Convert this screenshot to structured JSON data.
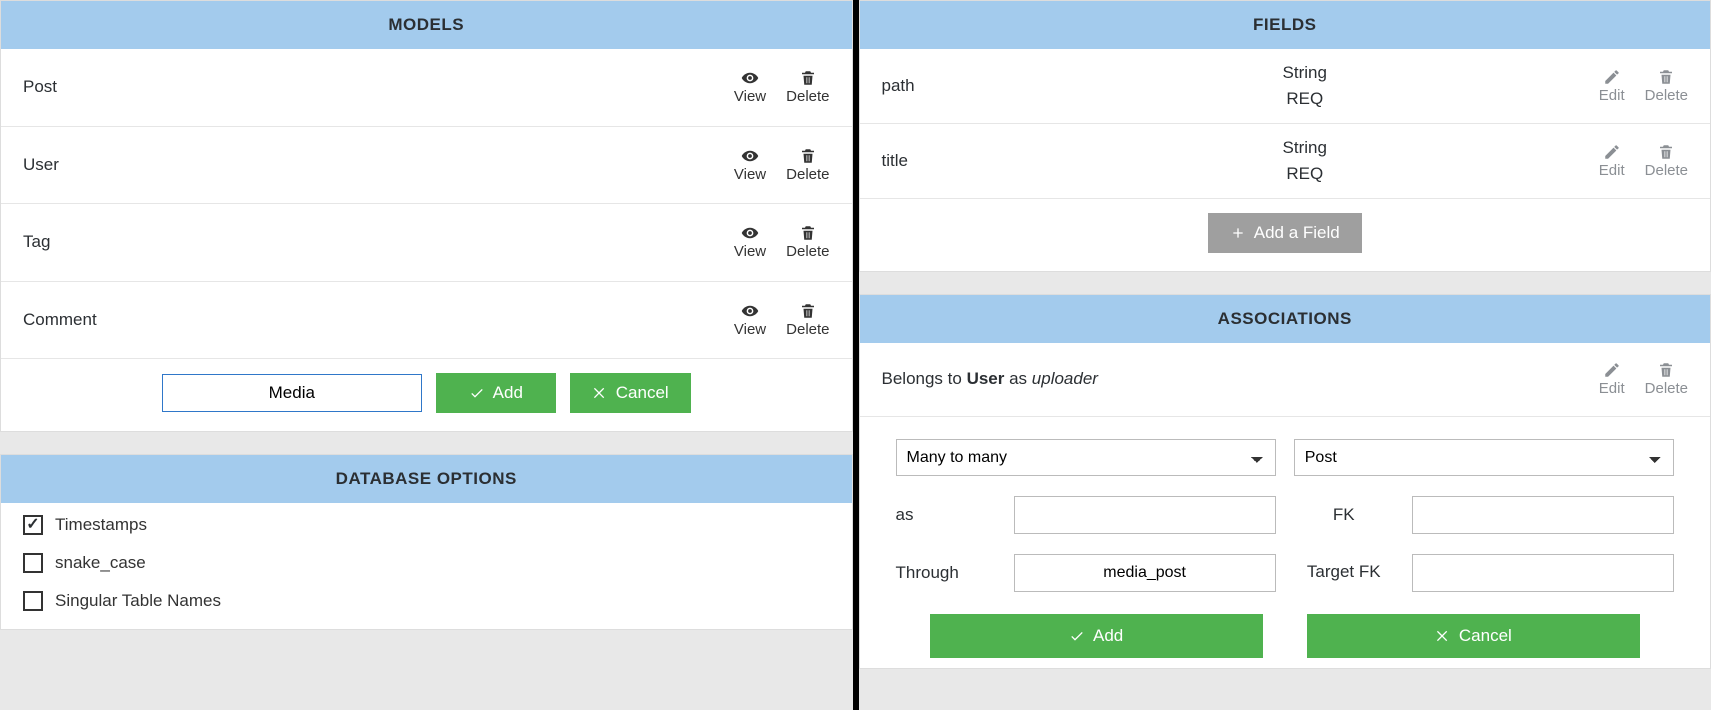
{
  "models": {
    "heading": "MODELS",
    "items": [
      {
        "name": "Post"
      },
      {
        "name": "User"
      },
      {
        "name": "Tag"
      },
      {
        "name": "Comment"
      }
    ],
    "action_view": "View",
    "action_delete": "Delete",
    "new_value": "Media",
    "add_label": "Add",
    "cancel_label": "Cancel"
  },
  "db_options": {
    "heading": "DATABASE OPTIONS",
    "timestamps_label": "Timestamps",
    "timestamps_checked": true,
    "snakecase_label": "snake_case",
    "snakecase_checked": false,
    "singular_label": "Singular Table Names",
    "singular_checked": false
  },
  "fields": {
    "heading": "FIELDS",
    "items": [
      {
        "name": "path",
        "type": "String",
        "req": "REQ"
      },
      {
        "name": "title",
        "type": "String",
        "req": "REQ"
      }
    ],
    "action_edit": "Edit",
    "action_delete": "Delete",
    "add_field_label": "Add a Field"
  },
  "associations": {
    "heading": "ASSOCIATIONS",
    "existing": {
      "prefix": "Belongs to ",
      "target": "User",
      "as_word": " as ",
      "alias": "uploader"
    },
    "action_edit": "Edit",
    "action_delete": "Delete",
    "form": {
      "relation_selected": "Many to many",
      "target_selected": "Post",
      "as_label": "as",
      "as_value": "",
      "fk_label": "FK",
      "fk_value": "",
      "through_label": "Through",
      "through_value": "media_post",
      "targetfk_label": "Target FK",
      "targetfk_value": ""
    },
    "add_label": "Add",
    "cancel_label": "Cancel"
  }
}
